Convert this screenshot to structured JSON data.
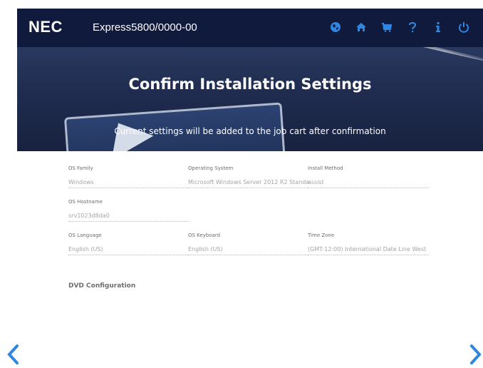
{
  "header": {
    "brand": "NEC",
    "model": "Express5800/0000-00",
    "icons": [
      "globe-icon",
      "home-icon",
      "cart-icon",
      "help-icon",
      "info-icon",
      "power-icon"
    ],
    "icon_color": "#2f86e0"
  },
  "hero": {
    "title": "Confirm Installation Settings",
    "subtitle": "Current settings will be added to the job cart after confirmation"
  },
  "fields": {
    "os_family": {
      "label": "OS Family",
      "value": "Windows"
    },
    "operating_system": {
      "label": "Operating System",
      "value": "Microsoft Windows Server 2012 R2 Standard"
    },
    "install_method": {
      "label": "Install Method",
      "value": "assist"
    },
    "os_hostname": {
      "label": "OS Hostname",
      "value": "srv1023d8da0"
    },
    "os_language": {
      "label": "OS Language",
      "value": "English (US)"
    },
    "os_keyboard": {
      "label": "OS Keyboard",
      "value": "English (US)"
    },
    "time_zone": {
      "label": "Time Zone",
      "value": "(GMT-12:00) International Date Line West"
    }
  },
  "sections": {
    "dvd": "DVD Configuration"
  },
  "nav": {
    "prev": "back-arrow-icon",
    "next": "forward-arrow-icon"
  }
}
